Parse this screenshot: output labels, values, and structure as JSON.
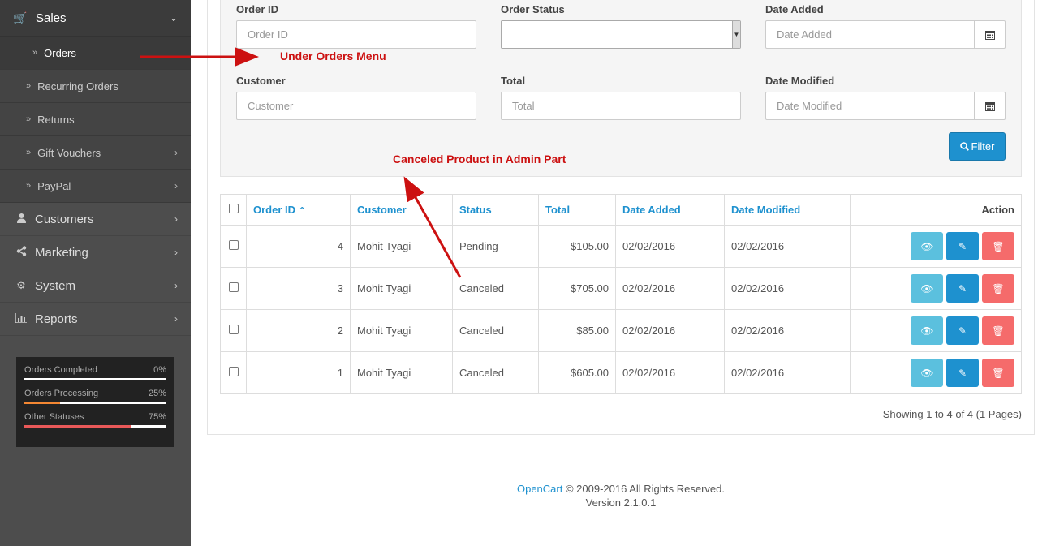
{
  "sidebar": {
    "sales": {
      "label": "Sales",
      "icon": "shopping-cart-icon"
    },
    "submenu": [
      {
        "label": "Orders",
        "active": true
      },
      {
        "label": "Recurring Orders"
      },
      {
        "label": "Returns"
      },
      {
        "label": "Gift Vouchers",
        "has_children": true
      },
      {
        "label": "PayPal",
        "has_children": true
      }
    ],
    "menu": [
      {
        "label": "Customers",
        "icon": "user-icon"
      },
      {
        "label": "Marketing",
        "icon": "share-icon"
      },
      {
        "label": "System",
        "icon": "cog-icon"
      },
      {
        "label": "Reports",
        "icon": "bar-chart-icon"
      }
    ],
    "stats": [
      {
        "label": "Orders Completed",
        "value": "0%",
        "fraction": 0.0,
        "color": "#4cae4c"
      },
      {
        "label": "Orders Processing",
        "value": "25%",
        "fraction": 0.25,
        "color": "#f38733"
      },
      {
        "label": "Other Statuses",
        "value": "75%",
        "fraction": 0.75,
        "color": "#e95858"
      }
    ]
  },
  "filter": {
    "order_id": {
      "label": "Order ID",
      "placeholder": "Order ID"
    },
    "order_status": {
      "label": "Order Status",
      "value": ""
    },
    "date_added": {
      "label": "Date Added",
      "placeholder": "Date Added"
    },
    "customer": {
      "label": "Customer",
      "placeholder": "Customer"
    },
    "total": {
      "label": "Total",
      "placeholder": "Total"
    },
    "date_modified": {
      "label": "Date Modified",
      "placeholder": "Date Modified"
    },
    "button": "Filter"
  },
  "table": {
    "headers": {
      "order_id": "Order ID",
      "customer": "Customer",
      "status": "Status",
      "total": "Total",
      "date_added": "Date Added",
      "date_modified": "Date Modified",
      "action": "Action"
    },
    "rows": [
      {
        "order_id": "4",
        "customer": "Mohit Tyagi",
        "status": "Pending",
        "total": "$105.00",
        "date_added": "02/02/2016",
        "date_modified": "02/02/2016"
      },
      {
        "order_id": "3",
        "customer": "Mohit Tyagi",
        "status": "Canceled",
        "total": "$705.00",
        "date_added": "02/02/2016",
        "date_modified": "02/02/2016"
      },
      {
        "order_id": "2",
        "customer": "Mohit Tyagi",
        "status": "Canceled",
        "total": "$85.00",
        "date_added": "02/02/2016",
        "date_modified": "02/02/2016"
      },
      {
        "order_id": "1",
        "customer": "Mohit Tyagi",
        "status": "Canceled",
        "total": "$605.00",
        "date_added": "02/02/2016",
        "date_modified": "02/02/2016"
      }
    ]
  },
  "pagination": {
    "text": "Showing 1 to 4 of 4 (1 Pages)"
  },
  "footer": {
    "brand": "OpenCart",
    "copyright": " © 2009-2016 All Rights Reserved.",
    "version": "Version 2.1.0.1"
  },
  "annotations": {
    "orders_menu": "Under Orders Menu",
    "canceled": "Canceled Product in Admin Part",
    "color": "#cc1111"
  }
}
